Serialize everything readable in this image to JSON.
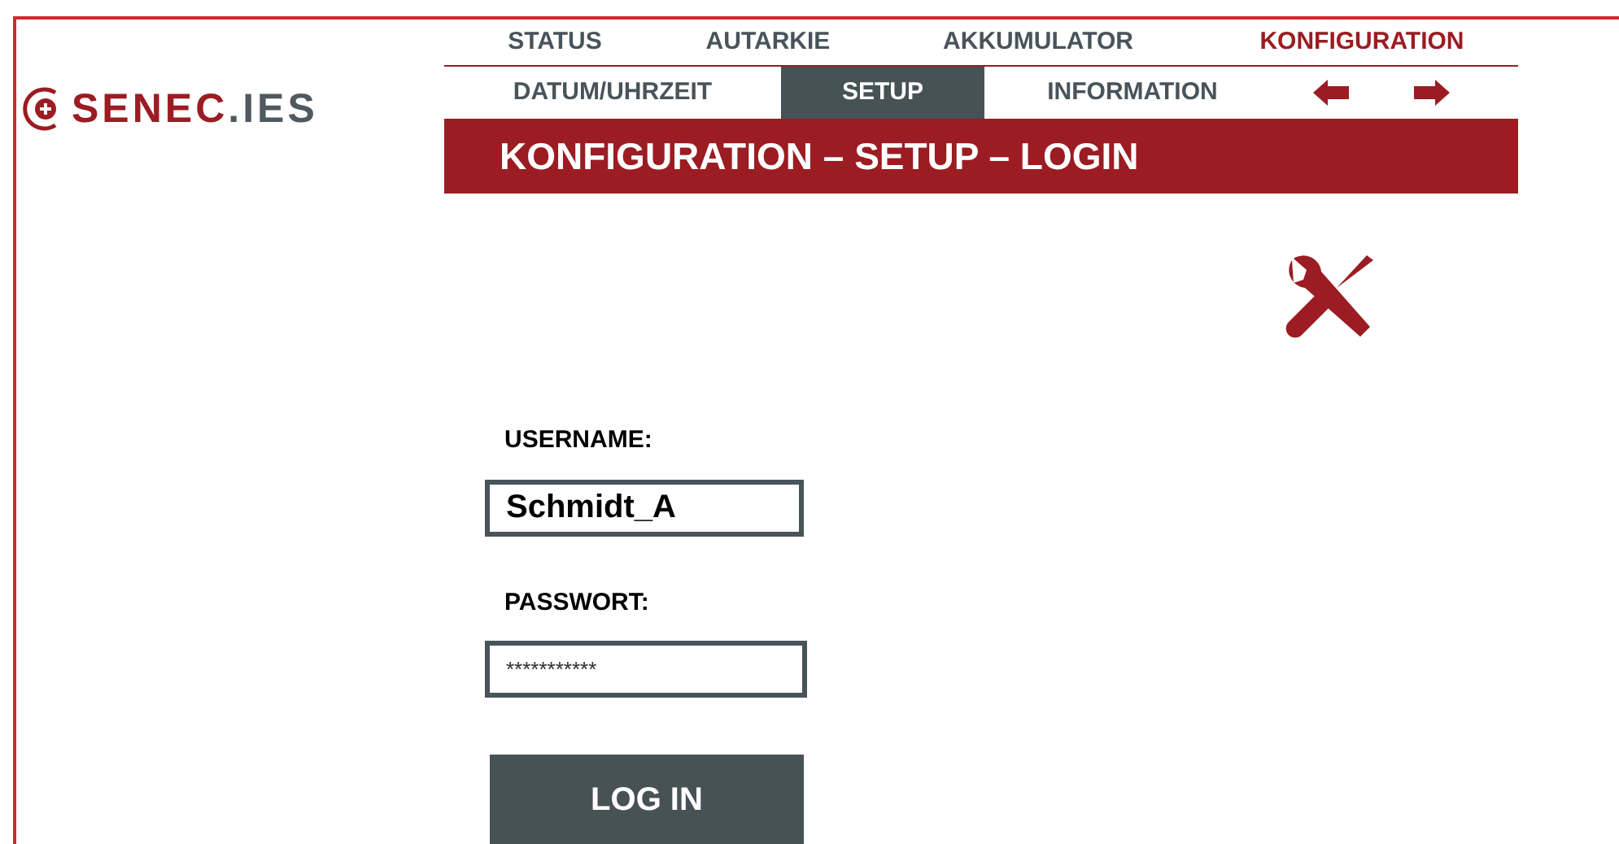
{
  "logo": {
    "brand": "SENEC",
    "suffix": ".IES"
  },
  "main_nav": [
    {
      "label": "STATUS",
      "selected": false
    },
    {
      "label": "AUTARKIE",
      "selected": false
    },
    {
      "label": "AKKUMULATOR",
      "selected": false
    },
    {
      "label": "KONFIGURATION",
      "selected": true
    }
  ],
  "sub_nav": [
    {
      "label": "DATUM/UHRZEIT",
      "selected": false
    },
    {
      "label": "SETUP",
      "selected": true
    },
    {
      "label": "INFORMATION",
      "selected": false
    }
  ],
  "page_title": "KONFIGURATION – SETUP – LOGIN",
  "form": {
    "username_label": "USERNAME:",
    "username_value": "Schmidt_A",
    "password_label": "PASSWORT:",
    "password_value": "***********",
    "submit": "LOG IN"
  }
}
